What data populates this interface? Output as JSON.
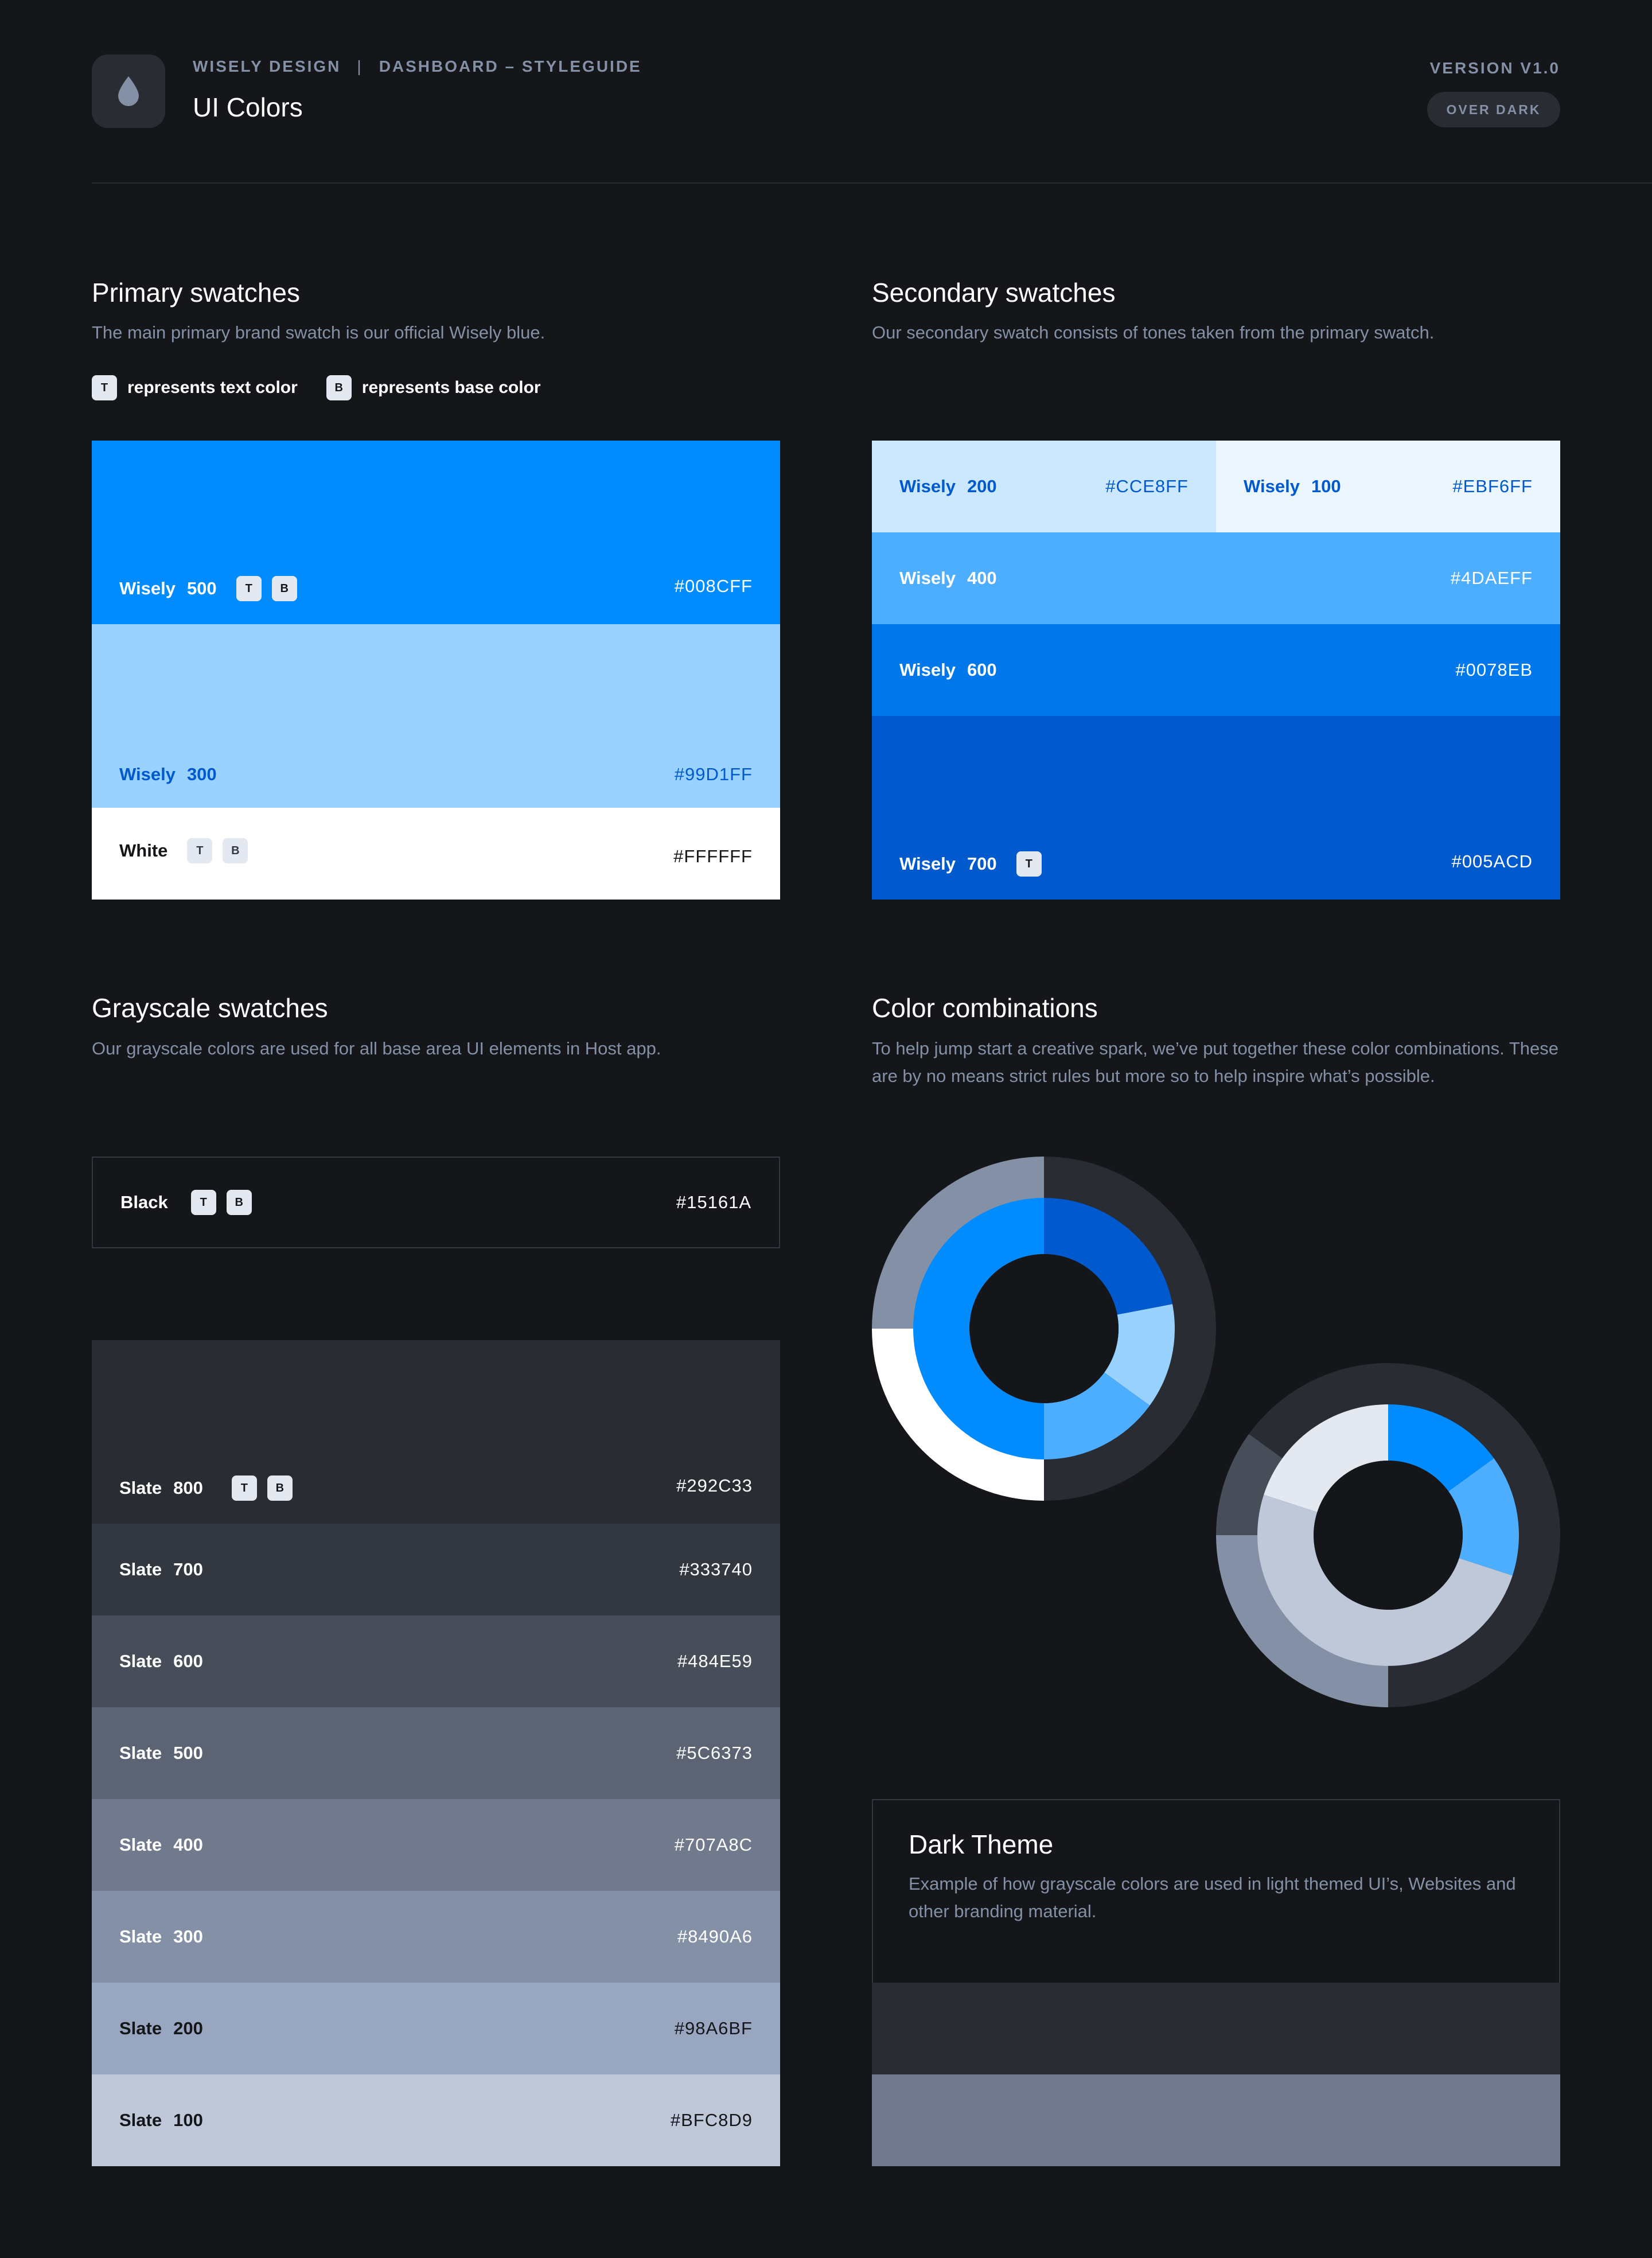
{
  "header": {
    "brand": "WISELY DESIGN",
    "separator": "|",
    "section": "DASHBOARD – STYLEGUIDE",
    "title": "UI Colors",
    "version": "VERSION V1.0",
    "theme_pill": "OVER DARK",
    "logo_icon": "drop-icon"
  },
  "legend": {
    "text_chip": "T",
    "text_label": "represents text color",
    "base_chip": "B",
    "base_label": "represents base color"
  },
  "primary": {
    "title": "Primary swatches",
    "desc": "The main primary brand swatch is our official Wisely blue.",
    "swatches": [
      {
        "name": "Wisely",
        "num": "500",
        "hex": "#008CFF",
        "color": "#008CFF",
        "text": "#FFFFFF"
      },
      {
        "name": "Wisely",
        "num": "300",
        "hex": "#99D1FF",
        "color": "#99D1FF",
        "text": "#005ACD"
      },
      {
        "name": "White",
        "num": "",
        "hex": "#FFFFFF",
        "color": "#FFFFFF",
        "text": "#15161A"
      }
    ]
  },
  "secondary": {
    "title": "Secondary swatches",
    "desc": "Our secondary swatch consists of tones taken from the primary swatch.",
    "swatches": [
      {
        "name": "Wisely",
        "num": "200",
        "hex": "#CCE8FF",
        "color": "#CCE8FF",
        "text": "#005ACD"
      },
      {
        "name": "Wisely",
        "num": "100",
        "hex": "#EBF6FF",
        "color": "#EBF6FF",
        "text": "#005ACD"
      },
      {
        "name": "Wisely",
        "num": "400",
        "hex": "#4DAEFF",
        "color": "#4DAEFF",
        "text": "#FFFFFF"
      },
      {
        "name": "Wisely",
        "num": "600",
        "hex": "#0078EB",
        "color": "#0078EB",
        "text": "#FFFFFF"
      },
      {
        "name": "Wisely",
        "num": "700",
        "hex": "#005ACD",
        "color": "#005ACD",
        "text": "#FFFFFF"
      }
    ]
  },
  "grayscale": {
    "title": "Grayscale swatches",
    "desc": "Our grayscale colors are used for all base area UI elements in Host app.",
    "black": {
      "name": "Black",
      "hex": "#15161A"
    },
    "swatches": [
      {
        "name": "Slate",
        "num": "800",
        "hex": "#292C33",
        "color": "#292C33",
        "text": "#FFFFFF"
      },
      {
        "name": "Slate",
        "num": "700",
        "hex": "#333740",
        "color": "#333740",
        "text": "#FFFFFF"
      },
      {
        "name": "Slate",
        "num": "600",
        "hex": "#484E59",
        "color": "#484E59",
        "text": "#FFFFFF"
      },
      {
        "name": "Slate",
        "num": "500",
        "hex": "#5C6373",
        "color": "#5C6373",
        "text": "#FFFFFF"
      },
      {
        "name": "Slate",
        "num": "400",
        "hex": "#707A8C",
        "color": "#707A8C",
        "text": "#FFFFFF"
      },
      {
        "name": "Slate",
        "num": "300",
        "hex": "#8490A6",
        "color": "#8490A6",
        "text": "#FFFFFF"
      },
      {
        "name": "Slate",
        "num": "200",
        "hex": "#98A6BF",
        "color": "#98A6BF",
        "text": "#15161A"
      },
      {
        "name": "Slate",
        "num": "100",
        "hex": "#BFC8D9",
        "color": "#BFC8D9",
        "text": "#15161A"
      }
    ]
  },
  "combinations": {
    "title": "Color combinations",
    "desc": "To help jump start a creative spark, we’ve put together these color combinations. These are by no means strict rules but more so to help inspire what’s possible.",
    "donut1": {
      "outer": [
        {
          "color": "#292C33",
          "value": 0.5
        },
        {
          "color": "#FFFFFF",
          "value": 0.25
        },
        {
          "color": "#8490A6",
          "value": 0.25
        }
      ],
      "inner": [
        {
          "color": "#0059CD",
          "value": 0.22
        },
        {
          "color": "#99D1FF",
          "value": 0.13
        },
        {
          "color": "#4DAEFF",
          "value": 0.15
        },
        {
          "color": "#008CFF",
          "value": 0.5
        }
      ]
    },
    "donut2": {
      "outer": [
        {
          "color": "#292C33",
          "value": 0.5
        },
        {
          "color": "#8490A6",
          "value": 0.25
        },
        {
          "color": "#484E59",
          "value": 0.1
        },
        {
          "color": "#292C33",
          "value": 0.15
        }
      ],
      "inner": [
        {
          "color": "#008CFF",
          "value": 0.15
        },
        {
          "color": "#4DAEFF",
          "value": 0.15
        },
        {
          "color": "#BFC8D9",
          "value": 0.5
        },
        {
          "color": "#E4E8F1",
          "value": 0.2
        }
      ]
    }
  },
  "dark_theme": {
    "title": "Dark Theme",
    "desc": "Example of how grayscale colors are used in light themed UI’s, Websites and other branding material.",
    "bands": [
      "#292C33",
      "#707A8C"
    ]
  }
}
